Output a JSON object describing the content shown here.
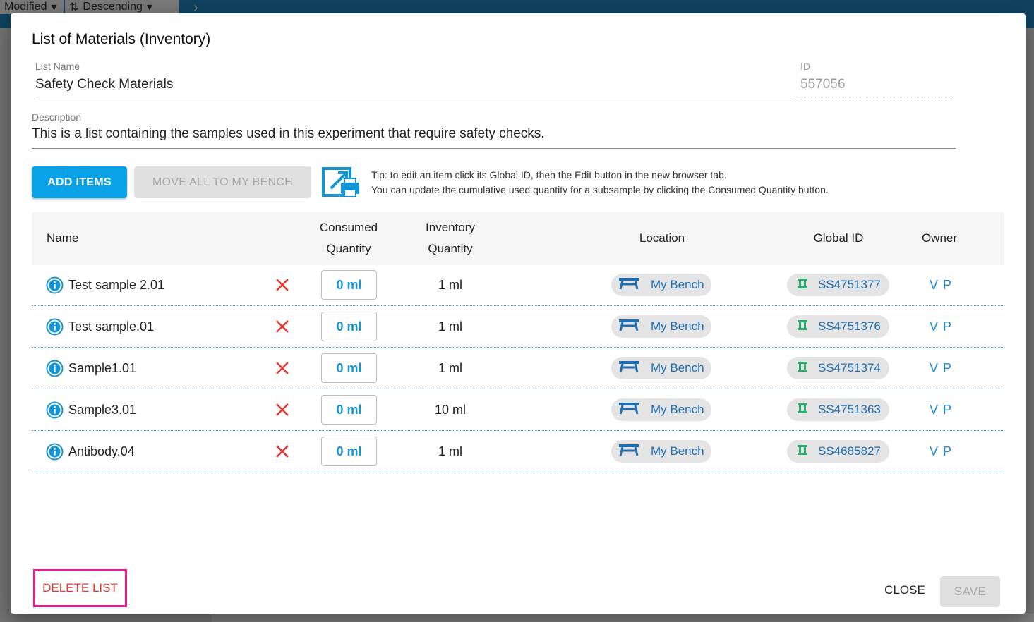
{
  "background": {
    "sort_field": "Modified",
    "sort_order": "Descending"
  },
  "dialog": {
    "title": "List of Materials (Inventory)",
    "list_name_label": "List Name",
    "list_name_value": "Safety Check Materials",
    "id_label": "ID",
    "id_value": "557056",
    "description_label": "Description",
    "description_value": "This is a list containing the samples used in this experiment that require safety checks.",
    "add_items_label": "ADD ITEMS",
    "move_all_label": "MOVE ALL TO MY BENCH",
    "tip_line1": "Tip: to edit an item click its Global ID, then the Edit button in the new browser tab.",
    "tip_line2": "You can update the cumulative used quantity for a subsample by clicking the Consumed Quantity button.",
    "delete_list_label": "DELETE LIST",
    "close_label": "CLOSE",
    "save_label": "SAVE"
  },
  "table": {
    "headers": {
      "name": "Name",
      "consumed_line1": "Consumed",
      "consumed_line2": "Quantity",
      "inventory_line1": "Inventory",
      "inventory_line2": "Quantity",
      "location": "Location",
      "global_id": "Global ID",
      "owner": "Owner"
    },
    "rows": [
      {
        "name": "Test sample 2.01",
        "consumed": "0 ml",
        "inventory": "1 ml",
        "location": "My Bench",
        "global_id": "SS4751377",
        "owner": "V P"
      },
      {
        "name": "Test sample.01",
        "consumed": "0 ml",
        "inventory": "1 ml",
        "location": "My Bench",
        "global_id": "SS4751376",
        "owner": "V P"
      },
      {
        "name": "Sample1.01",
        "consumed": "0 ml",
        "inventory": "1 ml",
        "location": "My Bench",
        "global_id": "SS4751374",
        "owner": "V P"
      },
      {
        "name": "Sample3.01",
        "consumed": "0 ml",
        "inventory": "10 ml",
        "location": "My Bench",
        "global_id": "SS4751363",
        "owner": "V P"
      },
      {
        "name": "Antibody.04",
        "consumed": "0 ml",
        "inventory": "1 ml",
        "location": "My Bench",
        "global_id": "SS4685827",
        "owner": "V P"
      }
    ]
  },
  "icons": {
    "info": "info-circle-icon",
    "remove": "close-x-icon",
    "location": "bench-icon",
    "global_id": "subsample-icon",
    "tip": "edit-print-icon"
  },
  "colors": {
    "accent": "#0aa2e6",
    "link": "#1d6fb5",
    "danger": "#e53935",
    "highlight": "#f0198d"
  }
}
